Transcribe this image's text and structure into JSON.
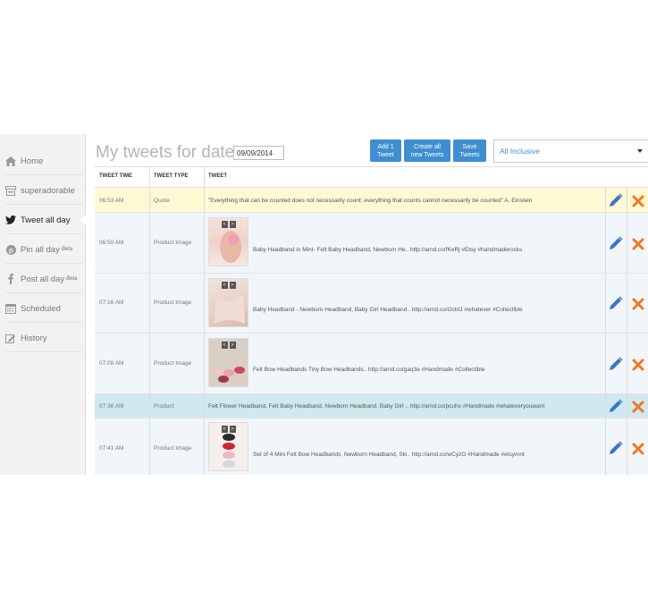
{
  "sidebar": {
    "items": [
      {
        "label": "Home",
        "icon": "home-icon"
      },
      {
        "label": "superadorable",
        "icon": "store-icon"
      },
      {
        "label": "Tweet all day",
        "icon": "twitter-icon",
        "active": true
      },
      {
        "label": "Pin all day",
        "icon": "pinterest-icon",
        "badge": "Beta"
      },
      {
        "label": "Post all day",
        "icon": "facebook-icon",
        "badge": "Beta"
      },
      {
        "label": "Scheduled",
        "icon": "calendar-icon"
      },
      {
        "label": "History",
        "icon": "history-icon"
      }
    ]
  },
  "header": {
    "title": "My tweets for date",
    "date_value": "09/09/2014",
    "buttons": {
      "add_one": "Add 1\nTweet",
      "create_all": "Create all\nnew Tweets",
      "save": "Save\nTweets"
    },
    "filter": {
      "selected": "All Inclusive"
    }
  },
  "table": {
    "columns": [
      "TWEET TIME",
      "TWEET TYPE",
      "TWEET"
    ],
    "rows": [
      {
        "time": "06:53 AM",
        "type": "Quote",
        "text": "\"Everything that can be counted does not necessarily count; everything that counts cannot necessarily be counted\" A. Einstein",
        "highlight": "quote"
      },
      {
        "time": "06:50 AM",
        "type": "Product Image",
        "text": "Baby Headband in Mint- Felt Baby Headband, Newborn He.. http://arnd.co/fKeRj #Etsy #handmaderocks",
        "image": "hand-headband"
      },
      {
        "time": "07:16 AM",
        "type": "Product Image",
        "text": "Baby Headband - Newborn Headband, Baby Girl Headband.. http://arnd.co/OcbIJ #whatever #Collectible",
        "image": "pink-fabric"
      },
      {
        "time": "07:08 AM",
        "type": "Product Image",
        "text": "Felt Bow Headbands Tiny Bow Headbands.. http://arnd.co/gaq3e #Handmade #Collectible",
        "image": "bows-row"
      },
      {
        "time": "07:38 AM",
        "type": "Product",
        "text": "Felt Flower Headband, Felt Baby Headband, Newborn Headband, Baby Girl .. http://arnd.co/pcuhx #Handmade #whateveryouwant",
        "highlight": "product"
      },
      {
        "time": "07:41 AM",
        "type": "Product Image",
        "text": "Set of 4 Mini Felt Bow Headbands, Newborn Headband, Ski.. http://arnd.co/wCyzO #Handmade #etsymnt",
        "image": "bows-stack"
      }
    ]
  },
  "colors": {
    "accent": "#3f8fd0",
    "quote_row": "#fdf9d3",
    "product_row": "#cfe9ee",
    "image_row": "#f1f6fb",
    "delete": "#f0781e",
    "edit": "#3f73c9"
  }
}
